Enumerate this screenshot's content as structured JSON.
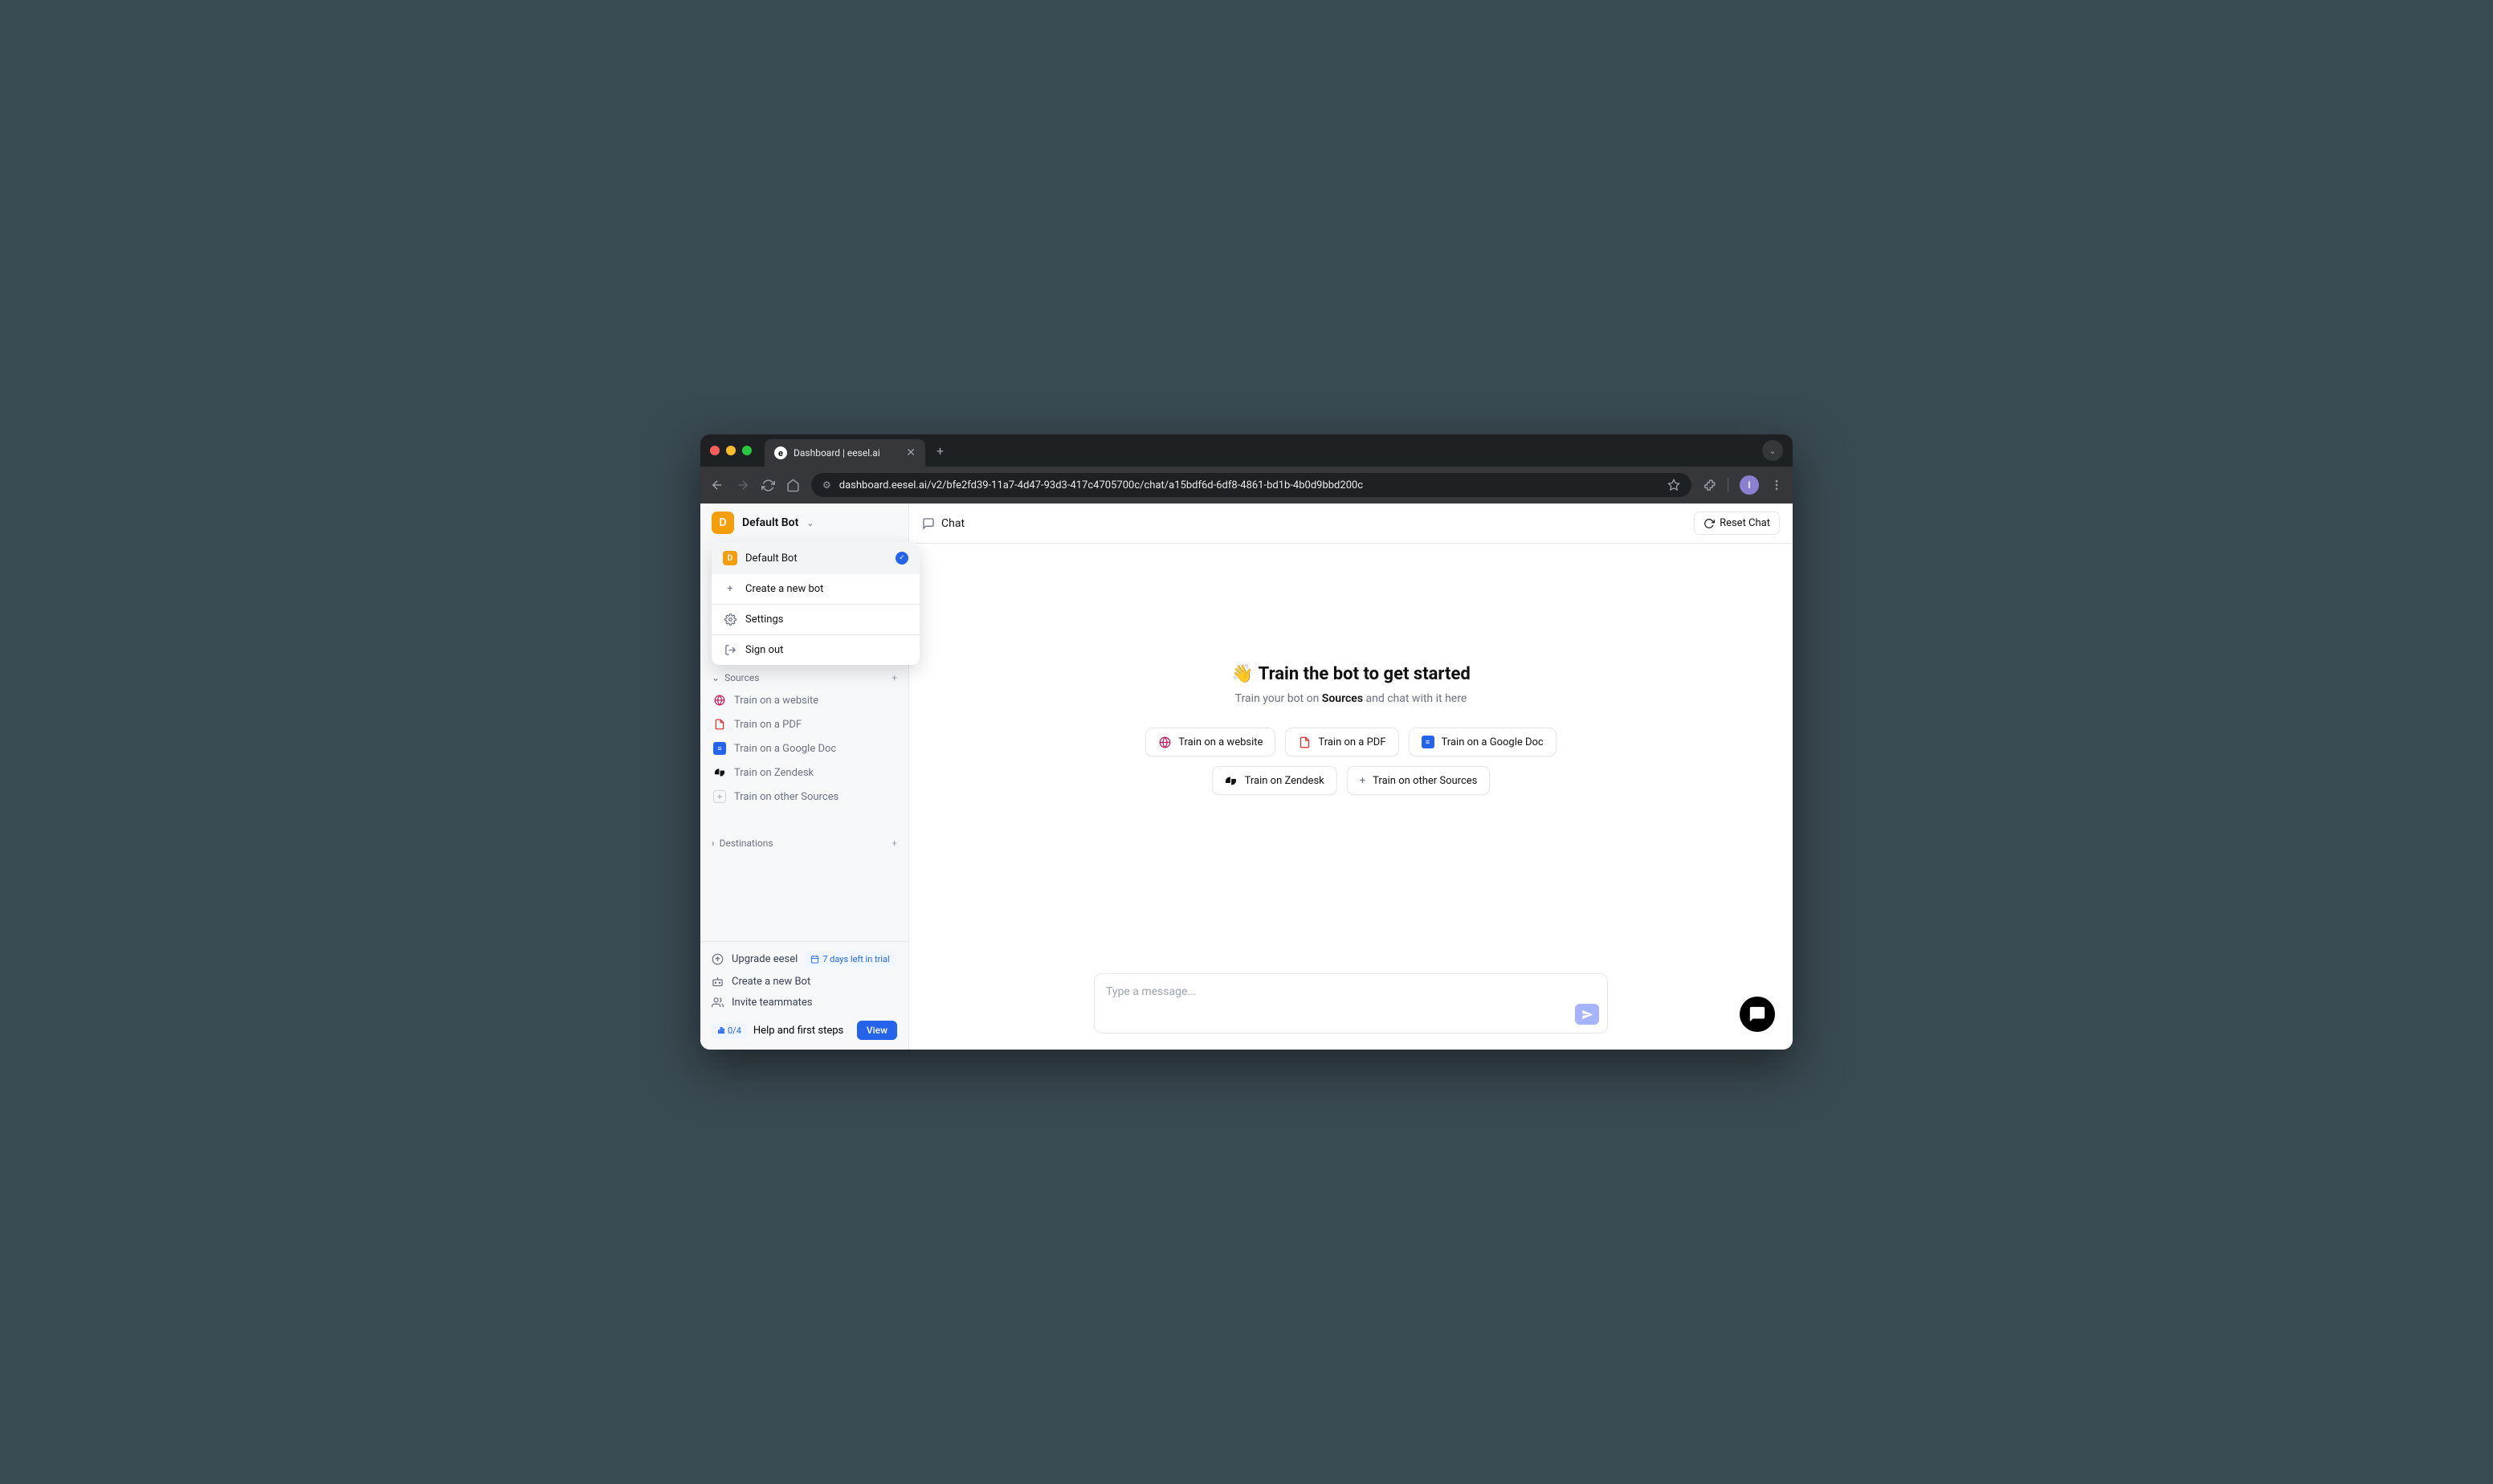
{
  "browser": {
    "tab_title": "Dashboard | eesel.ai",
    "url": "dashboard.eesel.ai/v2/bfe2fd39-11a7-4d47-93d3-417c4705700c/chat/a15bdf6d-6df8-4861-bd1b-4b0d9bbd200c",
    "avatar_letter": "I"
  },
  "sidebar": {
    "bot_avatar_letter": "D",
    "bot_name": "Default Bot",
    "dropdown": {
      "selected": "Default Bot",
      "create": "Create a new bot",
      "settings": "Settings",
      "signout": "Sign out"
    },
    "sources_label": "Sources",
    "sources": [
      "Train on a website",
      "Train on a PDF",
      "Train on a Google Doc",
      "Train on Zendesk",
      "Train on other Sources"
    ],
    "destinations_label": "Destinations",
    "footer": {
      "upgrade": "Upgrade eesel",
      "trial": "7 days left in trial",
      "create_bot": "Create a new Bot",
      "invite": "Invite teammates",
      "progress": "0/4",
      "help": "Help and first steps",
      "view": "View"
    }
  },
  "main": {
    "chat_label": "Chat",
    "reset": "Reset Chat",
    "headline": "Train the bot to get started",
    "subline_pre": "Train your bot on ",
    "subline_bold": "Sources",
    "subline_post": " and chat with it here",
    "chips": {
      "website": "Train on a website",
      "pdf": "Train on a PDF",
      "gdoc": "Train on a Google Doc",
      "zendesk": "Train on Zendesk",
      "other": "Train on other Sources"
    },
    "input_placeholder": "Type a message..."
  }
}
